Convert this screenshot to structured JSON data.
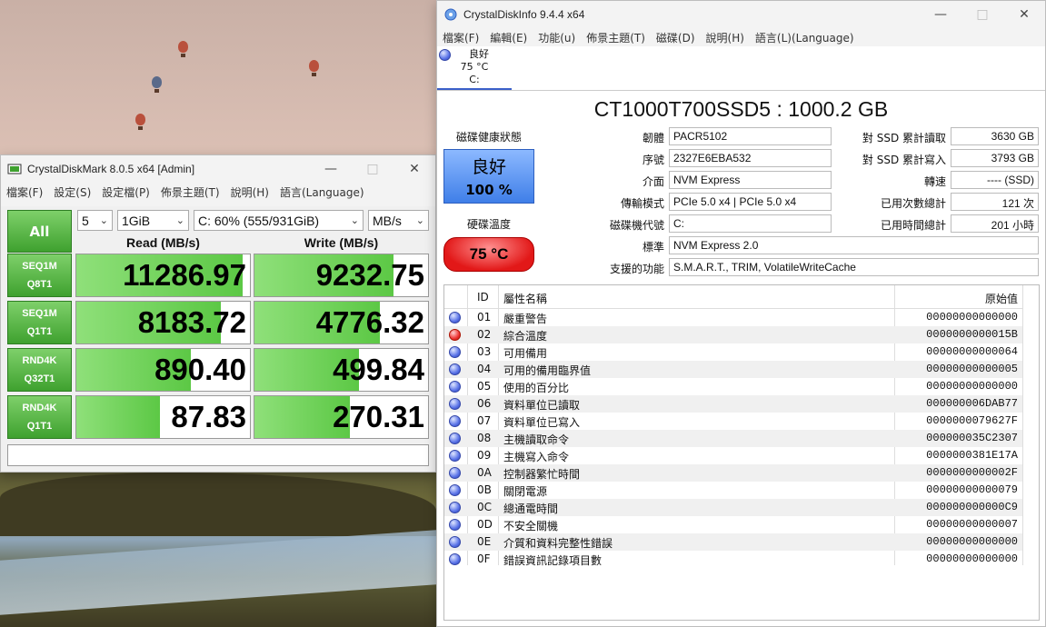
{
  "cdm": {
    "window_title": "CrystalDiskMark 8.0.5 x64 [Admin]",
    "menu": [
      "檔案(F)",
      "設定(S)",
      "設定檔(P)",
      "佈景主題(T)",
      "說明(H)",
      "語言(Language)"
    ],
    "all_label": "All",
    "count_value": "5",
    "size_value": "1GiB",
    "drive_value": "C: 60% (555/931GiB)",
    "unit_value": "MB/s",
    "read_header": "Read (MB/s)",
    "write_header": "Write (MB/s)",
    "tests": [
      {
        "line1": "SEQ1M",
        "line2": "Q8T1",
        "read": "11286.97",
        "write": "9232.75",
        "read_fill": 0.96,
        "write_fill": 0.8
      },
      {
        "line1": "SEQ1M",
        "line2": "Q1T1",
        "read": "8183.72",
        "write": "4776.32",
        "read_fill": 0.83,
        "write_fill": 0.72
      },
      {
        "line1": "RND4K",
        "line2": "Q32T1",
        "read": "890.40",
        "write": "499.84",
        "read_fill": 0.66,
        "write_fill": 0.6
      },
      {
        "line1": "RND4K",
        "line2": "Q1T1",
        "read": "87.83",
        "write": "270.31",
        "read_fill": 0.48,
        "write_fill": 0.55
      }
    ]
  },
  "cdi": {
    "window_title": "CrystalDiskInfo 9.4.4 x64",
    "menu": [
      "檔案(F)",
      "編輯(E)",
      "功能(u)",
      "佈景主題(T)",
      "磁碟(D)",
      "說明(H)",
      "語言(L)(Language)"
    ],
    "disk_tab": {
      "status": "良好",
      "temp": "75 °C",
      "drive": "C:"
    },
    "model_title": "CT1000T700SSD5 : 1000.2 GB",
    "health_label": "磁碟健康狀態",
    "health_status": "良好",
    "health_percent": "100 %",
    "temp_label": "硬碟溫度",
    "temp_value": "75 °C",
    "info": [
      {
        "label": "韌體",
        "value": "PACR5102"
      },
      {
        "label": "序號",
        "value": "2327E6EBA532"
      },
      {
        "label": "介面",
        "value": "NVM Express"
      },
      {
        "label": "傳輸模式",
        "value": "PCIe 5.0 x4 | PCIe 5.0 x4"
      },
      {
        "label": "磁碟機代號",
        "value": "C:"
      }
    ],
    "right_info": [
      {
        "label": "對 SSD 累計讀取",
        "value": "3630 GB"
      },
      {
        "label": "對 SSD 累計寫入",
        "value": "3793 GB"
      },
      {
        "label": "轉速",
        "value": "---- (SSD)"
      },
      {
        "label": "已用次數總計",
        "value": "121 次"
      },
      {
        "label": "已用時間總計",
        "value": "201 小時"
      }
    ],
    "standard_label": "標準",
    "standard_value": "NVM Express 2.0",
    "features_label": "支援的功能",
    "features_value": "S.M.A.R.T., TRIM, VolatileWriteCache",
    "smart_headers": {
      "id": "ID",
      "name": "屬性名稱",
      "raw": "原始值"
    },
    "smart": [
      {
        "id": "01",
        "name": "嚴重警告",
        "raw": "00000000000000",
        "status": "good"
      },
      {
        "id": "02",
        "name": "綜合溫度",
        "raw": "0000000000015B",
        "status": "warn"
      },
      {
        "id": "03",
        "name": "可用備用",
        "raw": "00000000000064",
        "status": "good"
      },
      {
        "id": "04",
        "name": "可用的備用臨界值",
        "raw": "00000000000005",
        "status": "good"
      },
      {
        "id": "05",
        "name": "使用的百分比",
        "raw": "00000000000000",
        "status": "good"
      },
      {
        "id": "06",
        "name": "資料單位已讀取",
        "raw": "000000006DAB77",
        "status": "good"
      },
      {
        "id": "07",
        "name": "資料單位已寫入",
        "raw": "0000000079627F",
        "status": "good"
      },
      {
        "id": "08",
        "name": "主機讀取命令",
        "raw": "000000035C2307",
        "status": "good"
      },
      {
        "id": "09",
        "name": "主機寫入命令",
        "raw": "0000000381E17A",
        "status": "good"
      },
      {
        "id": "0A",
        "name": "控制器繁忙時間",
        "raw": "0000000000002F",
        "status": "good"
      },
      {
        "id": "0B",
        "name": "關閉電源",
        "raw": "00000000000079",
        "status": "good"
      },
      {
        "id": "0C",
        "name": "總通電時間",
        "raw": "000000000000C9",
        "status": "good"
      },
      {
        "id": "0D",
        "name": "不安全關機",
        "raw": "00000000000007",
        "status": "good"
      },
      {
        "id": "0E",
        "name": "介質和資料完整性錯誤",
        "raw": "00000000000000",
        "status": "good"
      },
      {
        "id": "0F",
        "name": "錯誤資訊記錄項目數",
        "raw": "00000000000000",
        "status": "good"
      }
    ]
  }
}
